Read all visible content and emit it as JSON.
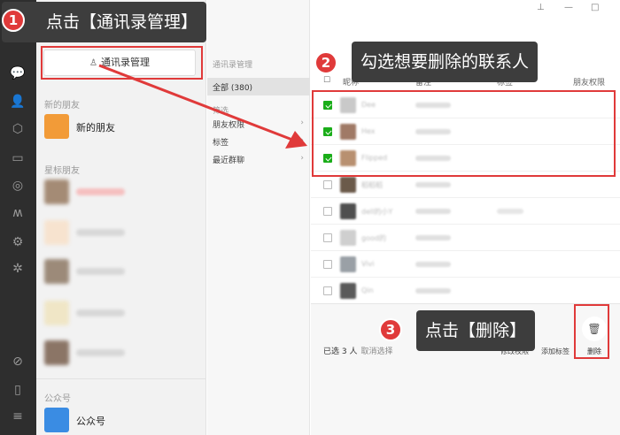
{
  "callouts": {
    "step1": {
      "num": "1",
      "text": "点击【通讯录管理】"
    },
    "step2": {
      "num": "2",
      "text": "勾选想要删除的联系人"
    },
    "step3": {
      "num": "3",
      "text": "点击【删除】"
    }
  },
  "contacts": {
    "manage_button": "通讯录管理",
    "new_friends_section": "新的朋友",
    "new_friends_item": "新的朋友",
    "starred_section": "星标朋友",
    "official_section": "公众号",
    "official_item": "公众号"
  },
  "filter": {
    "title": "通讯录管理",
    "all": "全部 (380)",
    "filter_section": "筛选",
    "permission": "朋友权限",
    "tags": "标签",
    "recent_groups": "最近群聊"
  },
  "list": {
    "headers": {
      "nickname": "昵称",
      "remark": "备注",
      "tag": "标签",
      "permission": "朋友权限"
    },
    "rows": [
      {
        "checked": true,
        "nick": "Dee"
      },
      {
        "checked": true,
        "nick": "Hex"
      },
      {
        "checked": true,
        "nick": "Flipped"
      },
      {
        "checked": false,
        "nick": "稻稻稻"
      },
      {
        "checked": false,
        "nick": "dell的小Y"
      },
      {
        "checked": false,
        "nick": "good的"
      },
      {
        "checked": false,
        "nick": "Vivi"
      },
      {
        "checked": false,
        "nick": "Qin"
      }
    ]
  },
  "bottom": {
    "selected": "已选 3 人",
    "cancel": "取消选择",
    "edit_permission": "修改权限",
    "add_tag": "添加标签",
    "delete": "删除"
  },
  "colors": {
    "accent_red": "#e03a3a",
    "check_green": "#1aad19",
    "callout_bg": "#3d3d3d"
  }
}
